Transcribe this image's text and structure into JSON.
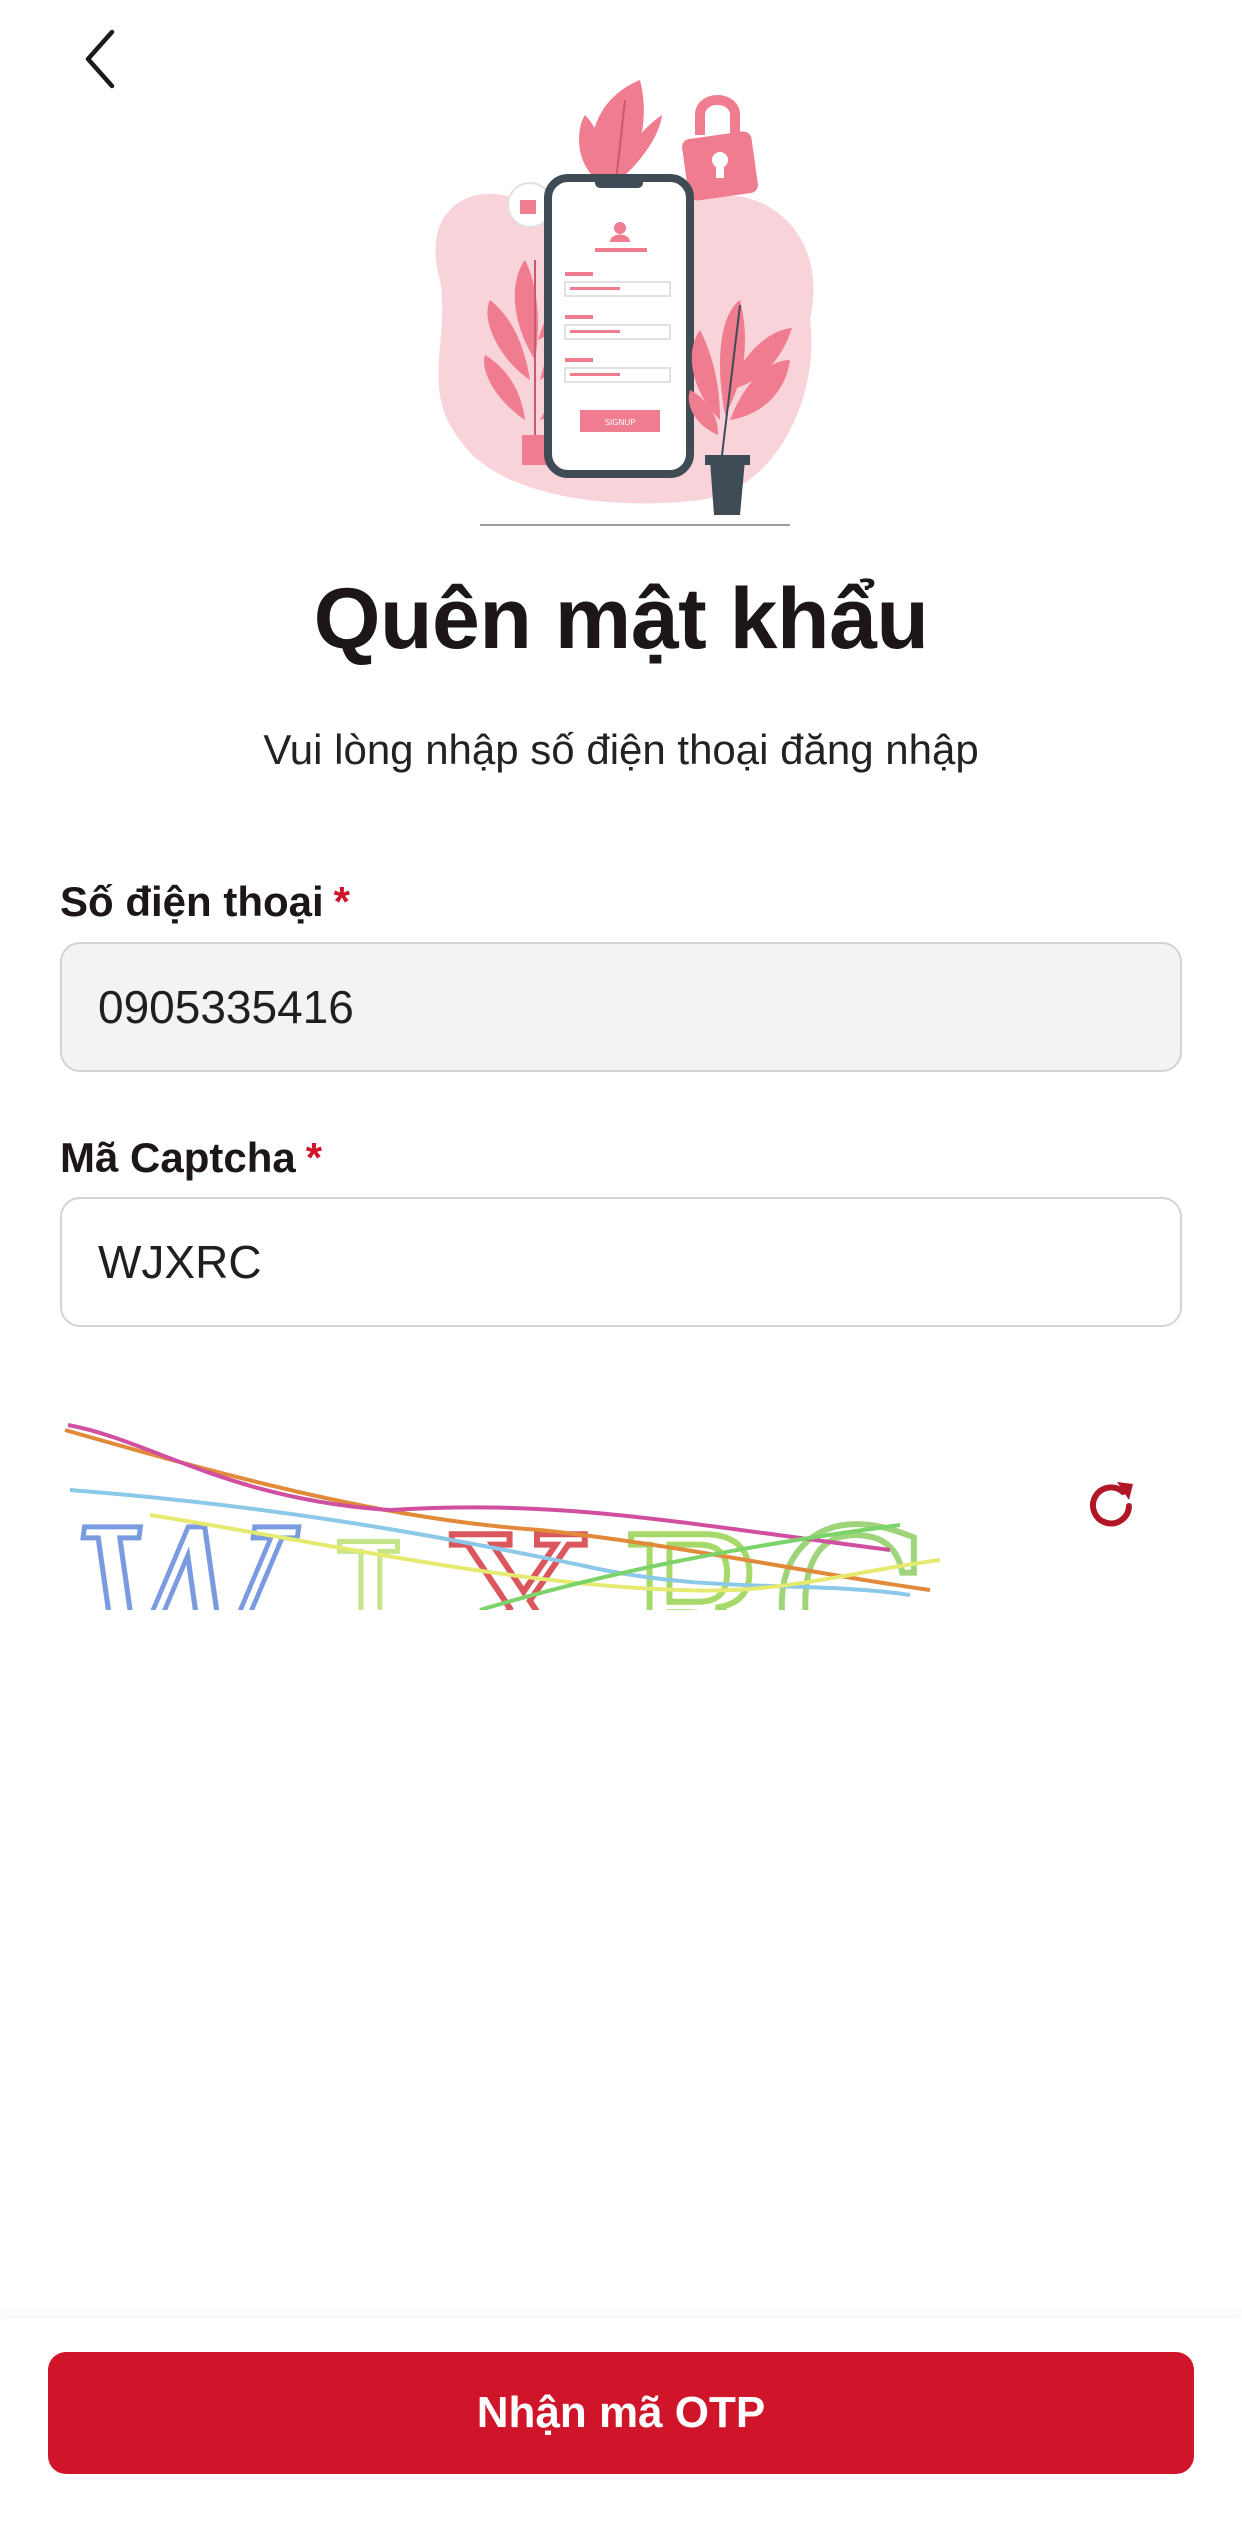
{
  "header": {
    "back_icon": "chevron-left-icon"
  },
  "main": {
    "title": "Quên mật khẩu",
    "subtitle": "Vui lòng nhập số điện thoại đăng nhập",
    "illustration_button_text": "SIGNUP"
  },
  "form": {
    "phone": {
      "label": "Số điện thoại",
      "required_mark": "*",
      "value": "0905335416"
    },
    "captcha": {
      "label": "Mã Captcha",
      "required_mark": "*",
      "value": "WJXRC"
    },
    "captcha_image": {
      "text": "WJXRC",
      "refresh_icon": "refresh-icon"
    }
  },
  "footer": {
    "submit_label": "Nhận mã OTP"
  },
  "colors": {
    "accent": "#d0152a",
    "illustration_pink": "#f07c8f",
    "illustration_blob": "#f9d3da",
    "phone_frame": "#3f4b55"
  }
}
